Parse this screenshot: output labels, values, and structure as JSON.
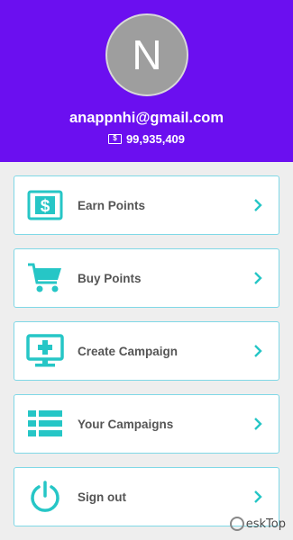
{
  "profile": {
    "avatar_letter": "N",
    "email": "anappnhi@gmail.com",
    "balance_icon": "dollar-bill-icon",
    "balance": "99,935,409"
  },
  "menu": [
    {
      "label": "Earn Points",
      "icon": "dollar-card-icon"
    },
    {
      "label": "Buy Points",
      "icon": "shopping-cart-icon"
    },
    {
      "label": "Create Campaign",
      "icon": "monitor-plus-icon"
    },
    {
      "label": "Your Campaigns",
      "icon": "list-icon"
    },
    {
      "label": "Sign out",
      "icon": "power-icon"
    }
  ],
  "colors": {
    "header": "#6b0ff0",
    "accent": "#26c6c6",
    "card_border": "#7fd8e6",
    "label": "#555555"
  }
}
